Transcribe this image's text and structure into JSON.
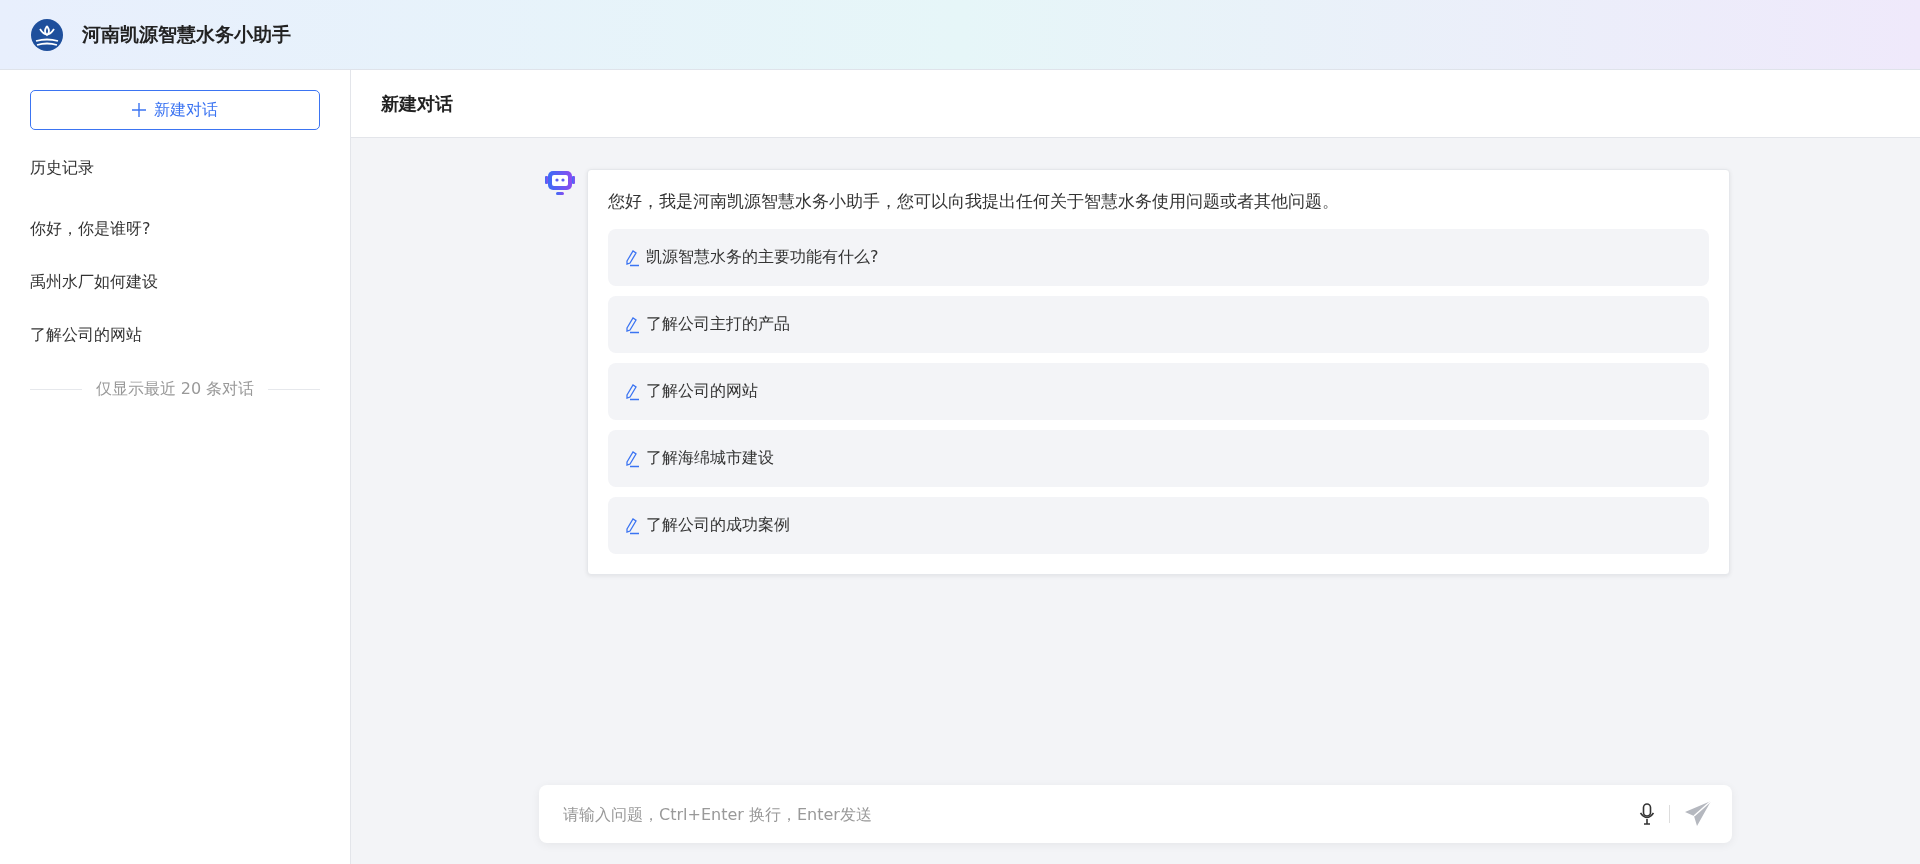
{
  "header": {
    "title": "河南凯源智慧水务小助手"
  },
  "sidebar": {
    "new_chat_button": "新建对话",
    "history_title": "历史记录",
    "items": [
      {
        "label": "你好，你是谁呀?"
      },
      {
        "label": "禹州水厂如何建设"
      },
      {
        "label": "了解公司的网站"
      }
    ],
    "footer_note": "仅显示最近 20 条对话"
  },
  "main": {
    "title": "新建对话",
    "greeting": "您好，我是河南凯源智慧水务小助手，您可以向我提出任何关于智慧水务使用问题或者其他问题。",
    "suggestions": [
      {
        "label": "凯源智慧水务的主要功能有什么?"
      },
      {
        "label": "了解公司主打的产品"
      },
      {
        "label": "了解公司的网站"
      },
      {
        "label": "了解海绵城市建设"
      },
      {
        "label": "了解公司的成功案例"
      }
    ],
    "input": {
      "placeholder": "请输入问题，Ctrl+Enter 换行，Enter发送"
    }
  }
}
